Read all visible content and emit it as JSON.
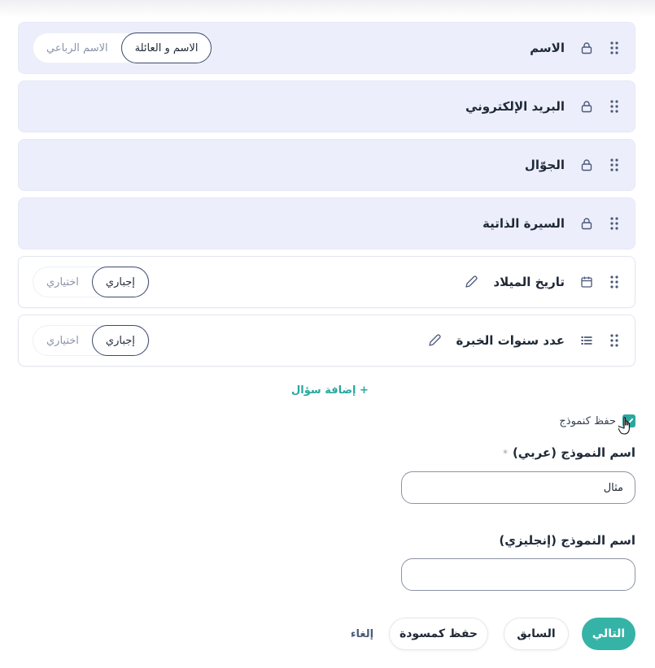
{
  "fields": [
    {
      "title": "الاسم",
      "type": "locked",
      "icon": "lock-icon",
      "toggle": {
        "active": "الاسم و العائلة",
        "inactive": "الاسم الرباعي"
      }
    },
    {
      "title": "البريد الإلكتروني",
      "type": "locked",
      "icon": "lock-icon"
    },
    {
      "title": "الجوّال",
      "type": "locked",
      "icon": "lock-icon"
    },
    {
      "title": "السيرة الذاتية",
      "type": "locked",
      "icon": "lock-icon"
    },
    {
      "title": "تاريخ الميلاد",
      "type": "editable",
      "icon": "calendar-icon",
      "toggle": {
        "active": "إجباري",
        "inactive": "اختياري"
      }
    },
    {
      "title": "عدد سنوات الخبرة",
      "type": "editable",
      "icon": "list-icon",
      "toggle": {
        "active": "إجباري",
        "inactive": "اختياري"
      }
    }
  ],
  "add_question": "+ إضافة سؤال",
  "save_template": {
    "label": "حفظ كنموذج",
    "checked": true
  },
  "template_name_ar": {
    "label": "اسم النموذج (عربي)",
    "required_mark": "*",
    "placeholder": "مثال"
  },
  "template_name_en": {
    "label": "اسم النموذج (إنجليزي)",
    "placeholder": ""
  },
  "buttons": {
    "next": "التالي",
    "previous": "السابق",
    "save_draft": "حفظ كمسودة",
    "cancel": "إلغاء"
  },
  "colors": {
    "accent": "#35b3a6",
    "locked_row_bg": "#eceefb",
    "text": "#1f2937"
  }
}
